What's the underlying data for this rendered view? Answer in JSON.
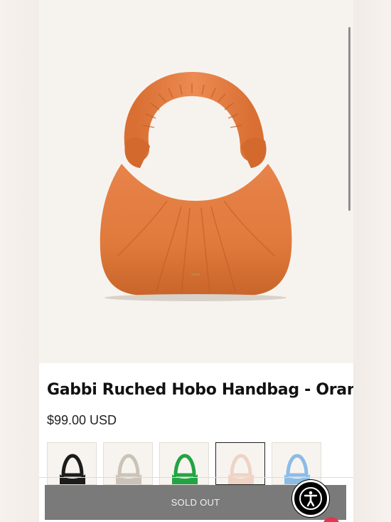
{
  "product": {
    "title": "Gabbi Ruched Hobo Handbag - Orange",
    "price": "$99.00 USD",
    "image_color": "#e07a3c"
  },
  "variants": [
    {
      "color_name": "black",
      "hex": "#1c1c1c",
      "selected": false
    },
    {
      "color_name": "beige",
      "hex": "#cbc3b8",
      "selected": false
    },
    {
      "color_name": "green",
      "hex": "#23a343",
      "selected": false
    },
    {
      "color_name": "light pink",
      "hex": "#efd3c4",
      "selected": true
    },
    {
      "color_name": "light blue",
      "hex": "#8cbce6",
      "selected": false
    }
  ],
  "actions": {
    "sold_out_label": "SOLD OUT"
  },
  "icons": {
    "accessibility": "accessibility-icon"
  }
}
